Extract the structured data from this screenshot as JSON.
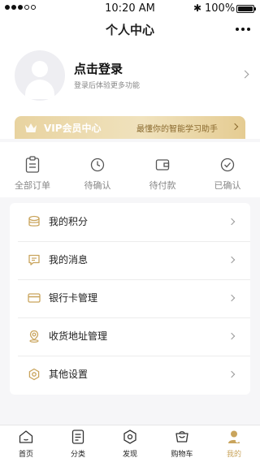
{
  "status_bar": {
    "time": "10:20 AM",
    "battery": "100%"
  },
  "header": {
    "title": "个人中心"
  },
  "profile": {
    "login_title": "点击登录",
    "login_subtitle": "登录后体验更多功能"
  },
  "vip": {
    "title": "VIP会员中心",
    "slogan": "最懂你的智能学习助手"
  },
  "orders": [
    {
      "label": "全部订单",
      "icon": "order-list-icon"
    },
    {
      "label": "待确认",
      "icon": "clock-icon"
    },
    {
      "label": "待付款",
      "icon": "wallet-icon"
    },
    {
      "label": "已确认",
      "icon": "check-circle-icon"
    }
  ],
  "menu": [
    {
      "label": "我的积分",
      "icon": "points-icon"
    },
    {
      "label": "我的消息",
      "icon": "message-icon"
    },
    {
      "label": "银行卡管理",
      "icon": "bank-card-icon"
    },
    {
      "label": "收货地址管理",
      "icon": "location-icon"
    },
    {
      "label": "其他设置",
      "icon": "settings-icon"
    }
  ],
  "tabbar": [
    {
      "label": "首页",
      "icon": "home-icon"
    },
    {
      "label": "分类",
      "icon": "category-icon"
    },
    {
      "label": "发现",
      "icon": "discover-icon"
    },
    {
      "label": "购物车",
      "icon": "cart-icon"
    },
    {
      "label": "我的",
      "icon": "profile-icon",
      "active": true
    }
  ],
  "colors": {
    "accent": "#c9a45c",
    "vip_gold": "#e8d3a0",
    "icon_gold": "#c9a45c"
  }
}
